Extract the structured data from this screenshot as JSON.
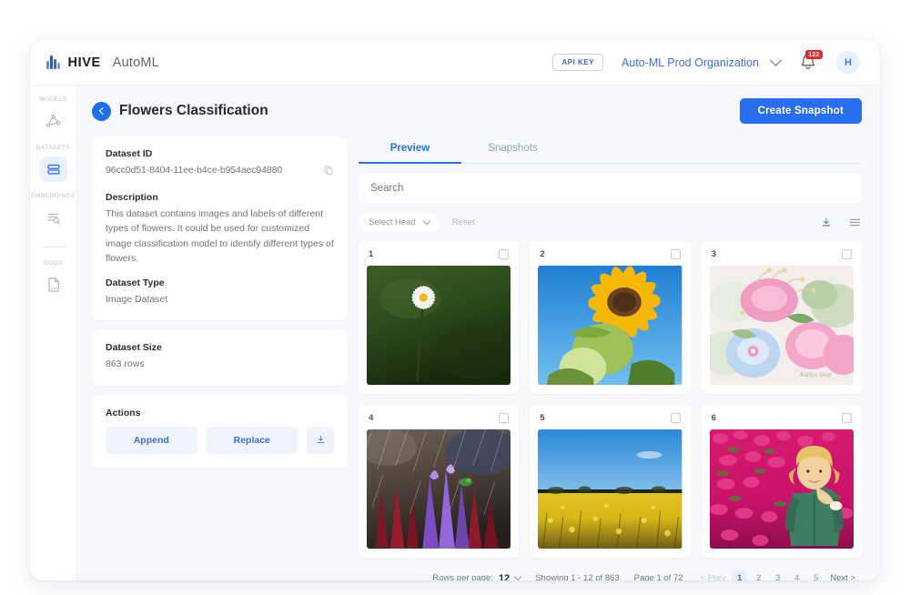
{
  "brand": {
    "name": "HIVE",
    "product": "AutoML",
    "logo_icon": "hive-bars-logo"
  },
  "header": {
    "api_key_label": "API KEY",
    "organization": "Auto-ML Prod Organization",
    "notification_count": "122",
    "avatar_initial": "H"
  },
  "sidebar": {
    "items": [
      {
        "label": "MODELS",
        "icon": "models-graph-icon",
        "active": false
      },
      {
        "label": "DATASETS",
        "icon": "datasets-stack-icon",
        "active": true
      },
      {
        "label": "EMBEDDINGS",
        "icon": "embeddings-search-icon",
        "active": false
      },
      {
        "label": "DOCS",
        "icon": "docs-page-icon",
        "active": false
      }
    ]
  },
  "page": {
    "title": "Flowers Classification",
    "back_icon": "chevron-left-icon",
    "create_snapshot_label": "Create Snapshot"
  },
  "details": {
    "dataset_id_label": "Dataset ID",
    "dataset_id_value": "96cc0d51-8404-11ee-b4ce-b954aec94880",
    "copy_icon": "copy-icon",
    "description_label": "Description",
    "description_value": "This dataset contains images and labels of different types of flowers. It could be used for customized image classification model to identify different types of flowers.",
    "dataset_type_label": "Dataset Type",
    "dataset_type_value": "Image Dataset",
    "dataset_size_label": "Dataset Size",
    "dataset_size_value": "863 rows",
    "actions_label": "Actions",
    "append_label": "Append",
    "replace_label": "Replace",
    "download_icon": "download-icon"
  },
  "tabs": [
    {
      "label": "Preview",
      "active": true
    },
    {
      "label": "Snapshots",
      "active": false
    }
  ],
  "search": {
    "placeholder": "Search",
    "value": ""
  },
  "filters": {
    "select_head_label": "Select Head",
    "reset_label": "Reset",
    "download_icon": "download-icon",
    "menu_icon": "hamburger-menu-icon"
  },
  "grid": {
    "items": [
      {
        "index": "1",
        "checked": false,
        "alt": "white daisy on green background"
      },
      {
        "index": "2",
        "checked": false,
        "alt": "yellow sunflower against blue sky"
      },
      {
        "index": "3",
        "checked": false,
        "alt": "pink and blue fabric ribbon flowers"
      },
      {
        "index": "4",
        "checked": false,
        "alt": "purple and red flowers in rain"
      },
      {
        "index": "5",
        "checked": false,
        "alt": "yellow flower field under blue sky"
      },
      {
        "index": "6",
        "checked": false,
        "alt": "child in pink tulip field"
      }
    ]
  },
  "pagination": {
    "rows_per_page_label": "Rows per page:",
    "rows_per_page_value": "12",
    "showing_text": "Showing 1 - 12 of 863",
    "page_text": "Page 1 of 72",
    "prev_label": "< Prev",
    "next_label": "Next >",
    "pages": [
      "1",
      "2",
      "3",
      "4",
      "5"
    ],
    "current_page": "1"
  },
  "colors": {
    "accent_blue": "#2b6df0",
    "badge_red": "#e8242a",
    "panel_bg": "#f7f8fb",
    "action_bg": "#eef3fe"
  }
}
